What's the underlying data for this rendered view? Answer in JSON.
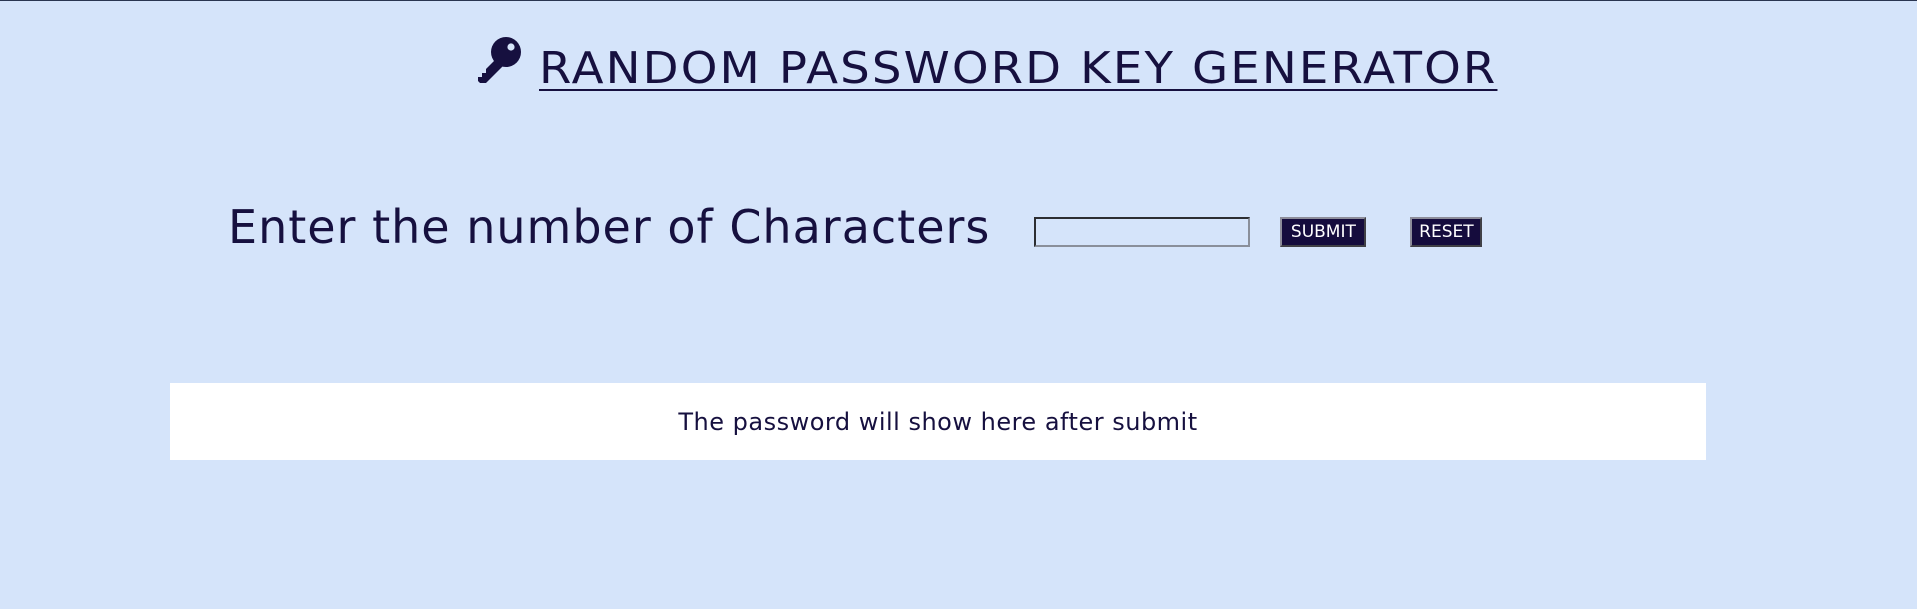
{
  "header": {
    "title": "RANDOM PASSWORD KEY GENERATOR",
    "icon": "key-icon"
  },
  "form": {
    "label": "Enter the number of Characters",
    "input_value": "",
    "input_placeholder": "",
    "submit_label": "SUBMIT",
    "reset_label": "RESET"
  },
  "output": {
    "message": "The password will show here after submit"
  },
  "colors": {
    "background": "#d5e4fa",
    "text": "#16103f",
    "button_bg": "#150c3d",
    "button_text": "#ffffff",
    "output_bg": "#ffffff"
  }
}
